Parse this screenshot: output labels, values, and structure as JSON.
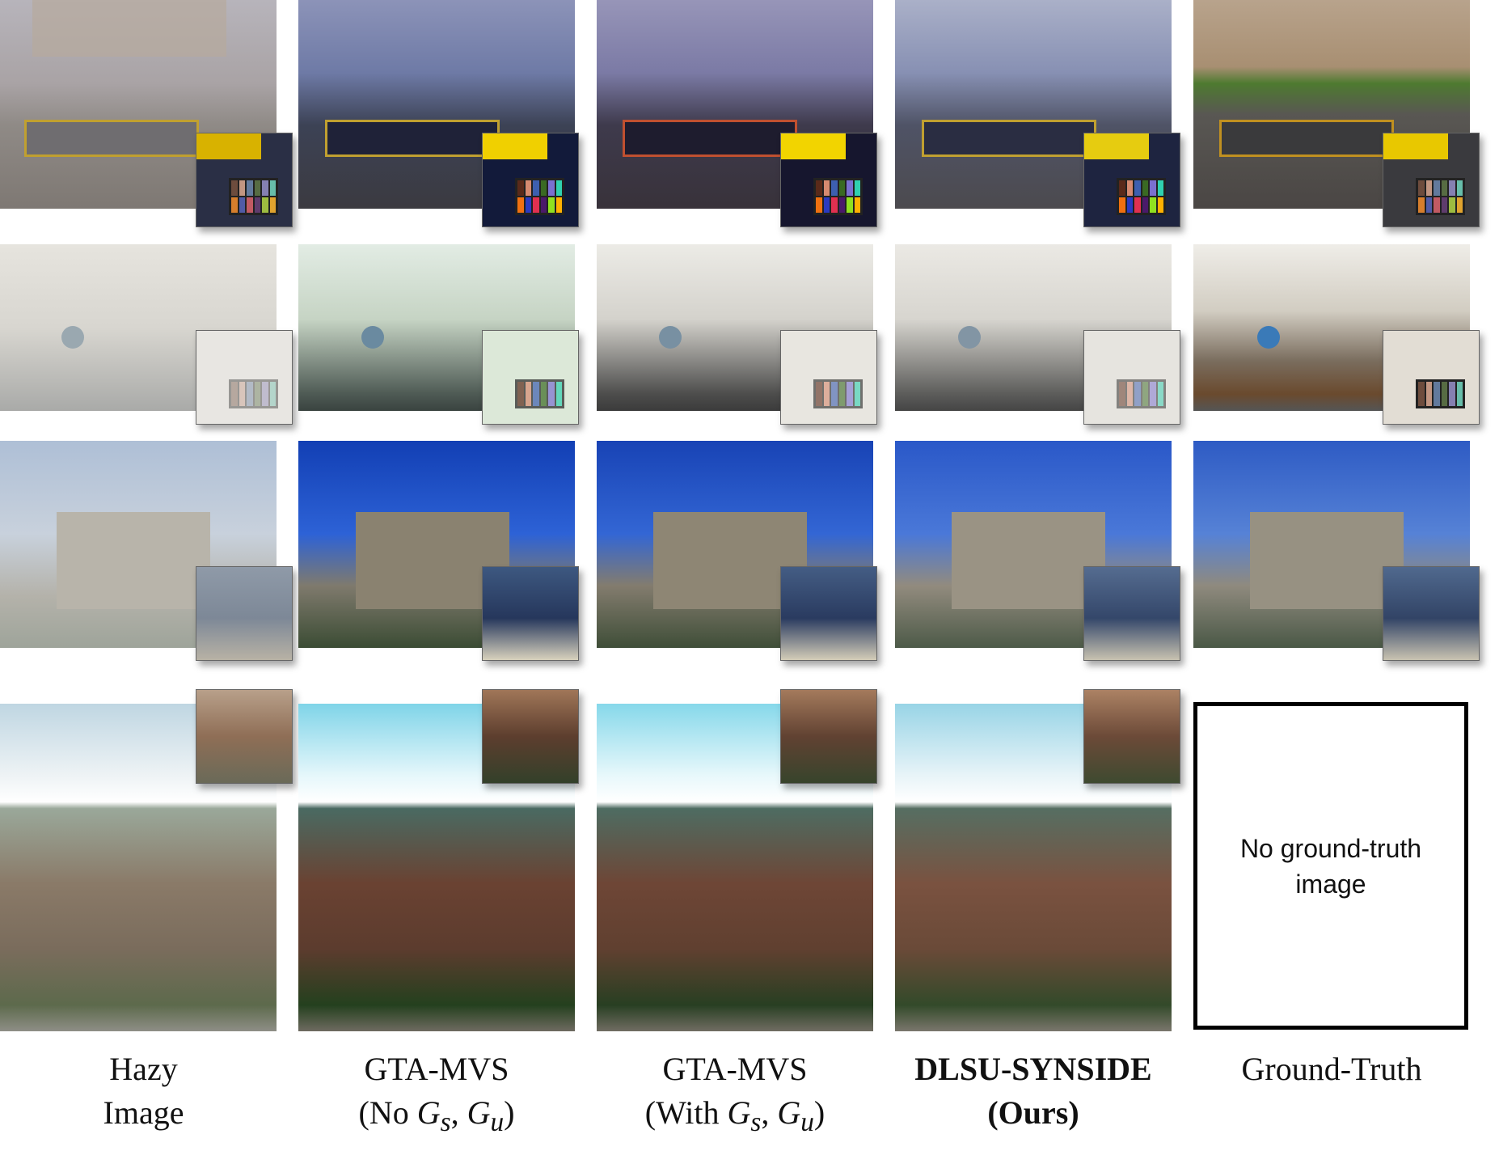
{
  "columns": [
    {
      "line1": "Hazy",
      "line2": "Image"
    },
    {
      "line1": "GTA-MVS",
      "line2a": "(No ",
      "math": "G",
      "sub1": "s",
      "comma": ", ",
      "math2": "G",
      "sub2": "u",
      "close": ")"
    },
    {
      "line1": "GTA-MVS",
      "line2a": "(With ",
      "math": "G",
      "sub1": "s",
      "comma": ", ",
      "math2": "G",
      "sub2": "u",
      "close": ")"
    },
    {
      "line1": "DLSU-SYNSIDE",
      "line2": "(Ours)"
    },
    {
      "line1": "Ground-Truth"
    }
  ],
  "no_ground_truth": {
    "line1": "No ground-truth",
    "line2": "image"
  },
  "rows": [
    {
      "scene": "playground"
    },
    {
      "scene": "living-room-sofa"
    },
    {
      "scene": "gate-tower"
    },
    {
      "scene": "city-hillside"
    }
  ],
  "colors": {
    "sky_blue": "#2f5fd0",
    "hazy_white": "#dcdcdc",
    "roof_red": "#a0523d"
  }
}
